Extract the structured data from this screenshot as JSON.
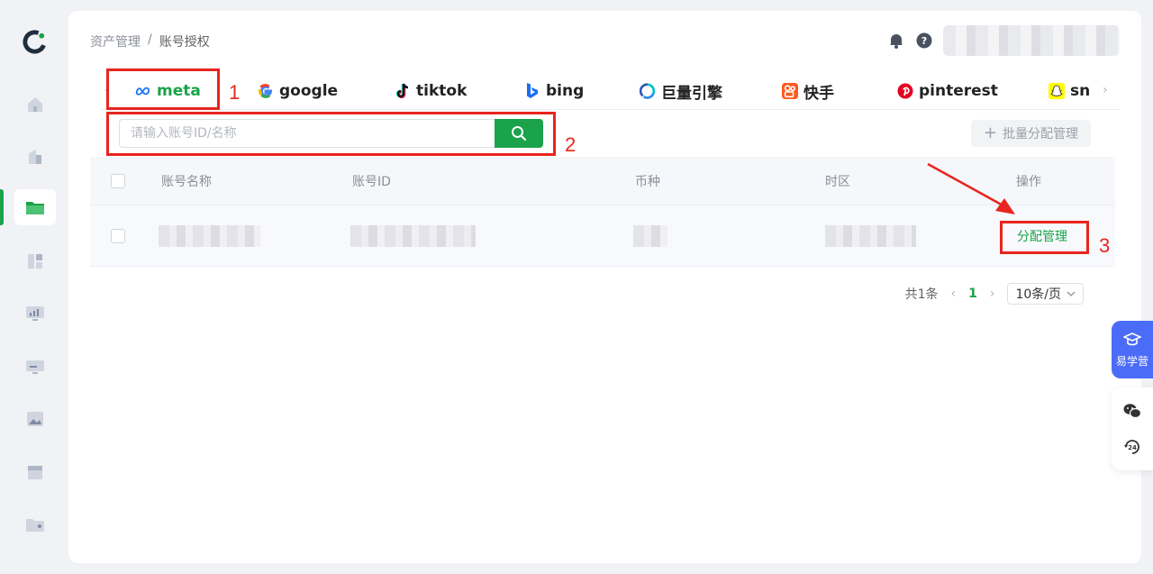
{
  "breadcrumb": {
    "parent": "资产管理",
    "separator": "/",
    "current": "账号授权"
  },
  "tabs": {
    "items": [
      {
        "label": "meta",
        "icon": "meta-icon"
      },
      {
        "label": "google",
        "icon": "google-icon"
      },
      {
        "label": "tiktok",
        "icon": "tiktok-icon"
      },
      {
        "label": "bing",
        "icon": "bing-icon"
      },
      {
        "label": "巨量引擎",
        "icon": "oceanengine-icon"
      },
      {
        "label": "快手",
        "icon": "kuaishou-icon"
      },
      {
        "label": "pinterest",
        "icon": "pinterest-icon"
      },
      {
        "label": "sn",
        "icon": "snapchat-icon"
      }
    ],
    "active": "meta"
  },
  "search": {
    "placeholder": "请输入账号ID/名称",
    "value": ""
  },
  "batch_button": {
    "label": "批量分配管理"
  },
  "table": {
    "columns": [
      "账号名称",
      "账号ID",
      "币种",
      "时区",
      "操作"
    ],
    "rows": [
      {
        "action": "分配管理"
      }
    ]
  },
  "pagination": {
    "total": "共1条",
    "current_page": "1",
    "page_size": "10条/页"
  },
  "float": {
    "learn_label": "易学营"
  },
  "annotations": {
    "one": "1",
    "two": "2",
    "three": "3"
  },
  "colors": {
    "accent": "#1aa34a",
    "annotation": "#e8251f",
    "float_blue": "#4b6cf7"
  }
}
